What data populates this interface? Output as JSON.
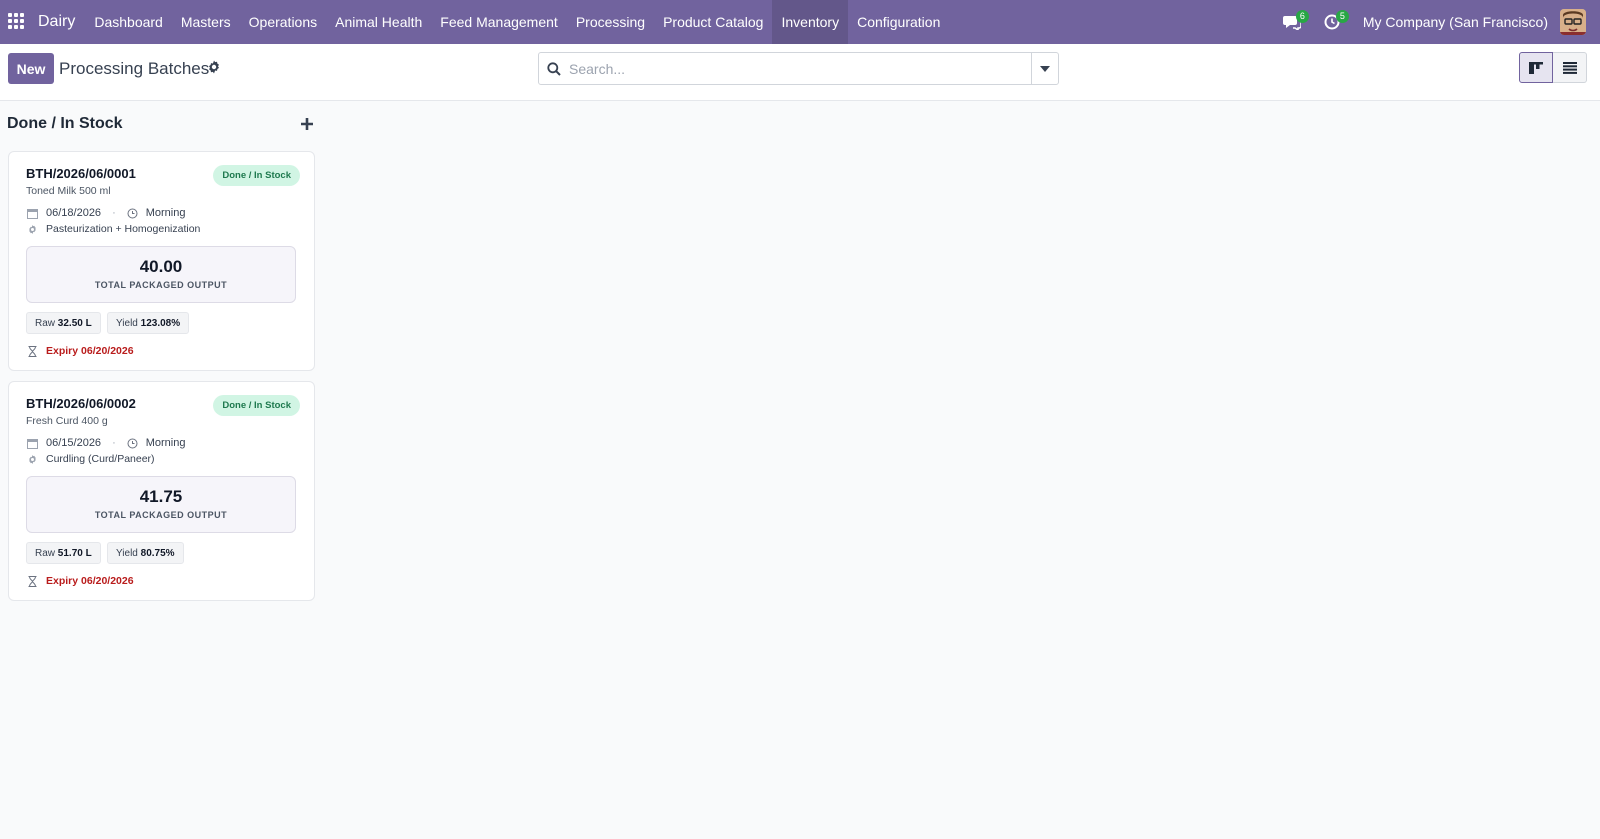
{
  "navbar": {
    "brand": "Dairy",
    "menu": [
      "Dashboard",
      "Masters",
      "Operations",
      "Animal Health",
      "Feed Management",
      "Processing",
      "Product Catalog",
      "Inventory",
      "Configuration"
    ],
    "active_menu": "Inventory",
    "messages_count": "6",
    "activities_count": "5",
    "company": "My Company (San Francisco)",
    "colors": {
      "bar": "#71639e",
      "badge": "#28a745"
    }
  },
  "control_panel": {
    "new_label": "New",
    "title": "Processing Batches",
    "search_placeholder": "Search..."
  },
  "kanban": {
    "column_title": "Done / In Stock",
    "cards": [
      {
        "name": "BTH/2026/06/0001",
        "product": "Toned Milk 500 ml",
        "status": "Done / In Stock",
        "date": "06/18/2026",
        "shift": "Morning",
        "process": "Pasteurization + Homogenization",
        "output": "40.00",
        "output_label": "TOTAL PACKAGED OUTPUT",
        "raw_label": "Raw",
        "raw_value": "32.50 L",
        "yield_label": "Yield",
        "yield_value": "123.08%",
        "expiry": "Expiry 06/20/2026"
      },
      {
        "name": "BTH/2026/06/0002",
        "product": "Fresh Curd 400 g",
        "status": "Done / In Stock",
        "date": "06/15/2026",
        "shift": "Morning",
        "process": "Curdling (Curd/Paneer)",
        "output": "41.75",
        "output_label": "TOTAL PACKAGED OUTPUT",
        "raw_label": "Raw",
        "raw_value": "51.70 L",
        "yield_label": "Yield",
        "yield_value": "80.75%",
        "expiry": "Expiry 06/20/2026"
      }
    ]
  }
}
